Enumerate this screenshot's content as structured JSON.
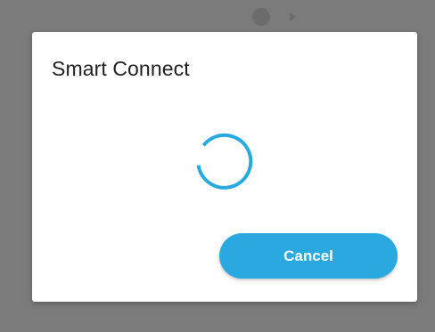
{
  "dialog": {
    "title": "Smart Connect",
    "status": "loading",
    "cancel_label": "Cancel"
  },
  "colors": {
    "accent": "#2aa9e0",
    "overlay": "#7b7b7b",
    "dialog_bg": "#ffffff",
    "title_text": "#212121"
  },
  "icons": {
    "spinner": "loading-spinner-icon"
  }
}
